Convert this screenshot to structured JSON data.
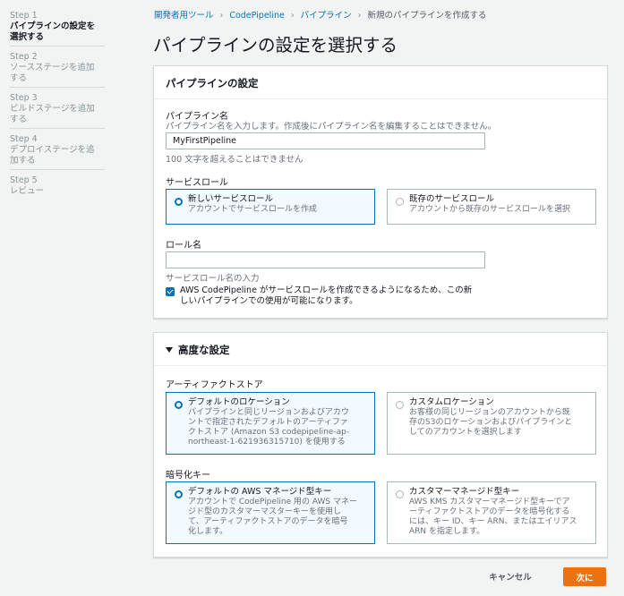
{
  "steps": [
    {
      "num": "Step 1",
      "title_lines": [
        "パイプラインの設定を",
        "選択する"
      ]
    },
    {
      "num": "Step 2",
      "title_lines": [
        "ソースステージを追加",
        "する"
      ]
    },
    {
      "num": "Step 3",
      "title_lines": [
        "ビルドステージを追加",
        "する"
      ]
    },
    {
      "num": "Step 4",
      "title_lines": [
        "デプロイステージを追",
        "加する"
      ]
    },
    {
      "num": "Step 5",
      "title_lines": [
        "レビュー"
      ]
    }
  ],
  "breadcrumb": {
    "items": [
      "開発者用ツール",
      "CodePipeline",
      "パイプライン"
    ],
    "current": "新規のパイプラインを作成する",
    "separator": "›"
  },
  "page_title": "パイプラインの設定を選択する",
  "pipeline_settings": {
    "header": "パイプラインの設定",
    "name_label": "パイプライン名",
    "name_desc": "パイプライン名を入力します。作成後にパイプライン名を編集することはできません。",
    "name_value": "MyFirstPipeline",
    "name_hint": "100 文字を超えることはできません",
    "service_role_label": "サービスロール",
    "role_options": [
      {
        "title": "新しいサービスロール",
        "desc_lines": [
          "アカウントでサービスロールを作成"
        ]
      },
      {
        "title": "既存のサービスロール",
        "desc_lines": [
          "アカウントから既存のサービスロールを選択"
        ]
      }
    ],
    "role_name_label": "ロール名",
    "role_name_value": "",
    "role_name_hint": "サービスロール名の入力",
    "checkbox_lines": [
      "AWS CodePipeline がサービスロールを作成できるようになるため、この新",
      "しいパイプラインでの使用が可能になります。"
    ]
  },
  "advanced": {
    "header": "高度な設定",
    "artifact_label": "アーティファクトストア",
    "artifact_options": [
      {
        "title": "デフォルトのロケーション",
        "desc_lines": [
          "パイプラインと同じリージョンおよびアカウ",
          "ントで指定されたデフォルトのアーティファ",
          "クトストア (Amazon S3 codepipeline-ap-",
          "northeast-1-621936315710) を使用する"
        ]
      },
      {
        "title": "カスタムロケーション",
        "desc_lines": [
          "お客様の同じリージョンのアカウントから既",
          "存のS3のロケーションおよびパイプラインと",
          "してのアカウントを選択します"
        ]
      }
    ],
    "encryption_label": "暗号化キー",
    "encryption_options": [
      {
        "title": "デフォルトの AWS マネージド型キー",
        "desc_lines": [
          "アカウントで CodePipeline 用の AWS マネー",
          "ジド型のカスタマーマスターキーを使用し",
          "て、アーティファクトストアのデータを暗号",
          "化します。"
        ]
      },
      {
        "title": "カスタマーマネージド型キー",
        "desc_lines": [
          "AWS KMS カスタマーマネージド型キーでア",
          "ーティファクトストアのデータを暗号化する",
          "には、キー ID、キー ARN、またはエイリアス",
          "ARN を指定します。"
        ]
      }
    ]
  },
  "footer": {
    "cancel": "キャンセル",
    "next": "次に"
  },
  "colors": {
    "accent": "#0073bb",
    "primary_button": "#ec7211",
    "background": "#f2f3f3"
  }
}
